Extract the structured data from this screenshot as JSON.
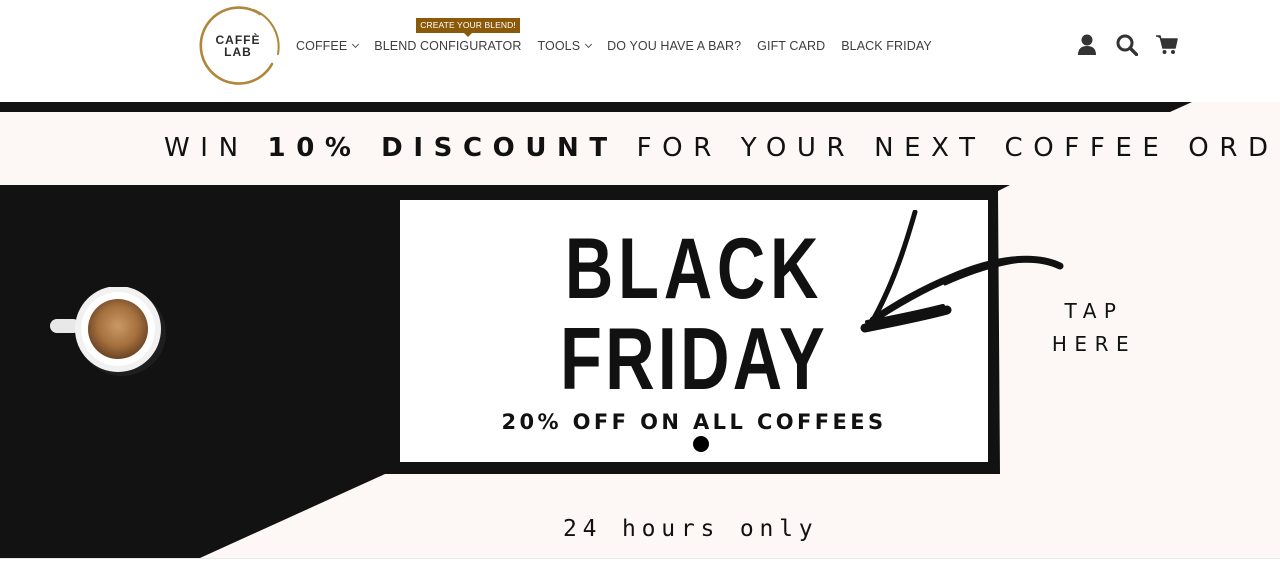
{
  "header": {
    "logo": {
      "line1": "CAFFÈ",
      "line2": "LAB",
      "ring_color": "#b0863a"
    },
    "nav": [
      {
        "label": "COFFEE",
        "has_dropdown": true
      },
      {
        "label": "BLEND CONFIGURATOR",
        "has_dropdown": false,
        "badge": "CREATE YOUR BLEND!"
      },
      {
        "label": "TOOLS",
        "has_dropdown": true
      },
      {
        "label": "DO YOU HAVE A BAR?",
        "has_dropdown": false
      },
      {
        "label": "GIFT CARD",
        "has_dropdown": false
      },
      {
        "label": "BLACK FRIDAY",
        "has_dropdown": false
      }
    ],
    "icons": [
      "user-icon",
      "search-icon",
      "cart-icon"
    ]
  },
  "hero": {
    "win_prefix": "WIN ",
    "win_bold": "10% DISCOUNT",
    "win_suffix": " FOR YOUR NEXT COFFEE ORDER",
    "title_line1": "BLACK",
    "title_line2": "FRIDAY",
    "offer": "20% OFF ON ALL COFFEES",
    "tap_line1": "TAP",
    "tap_line2": "HERE",
    "duration": "24 hours only",
    "slider_dots": 1,
    "colors": {
      "accent_badge": "#8a5a0a",
      "dark": "#121212",
      "hero_bg": "#fdf8f6"
    }
  }
}
